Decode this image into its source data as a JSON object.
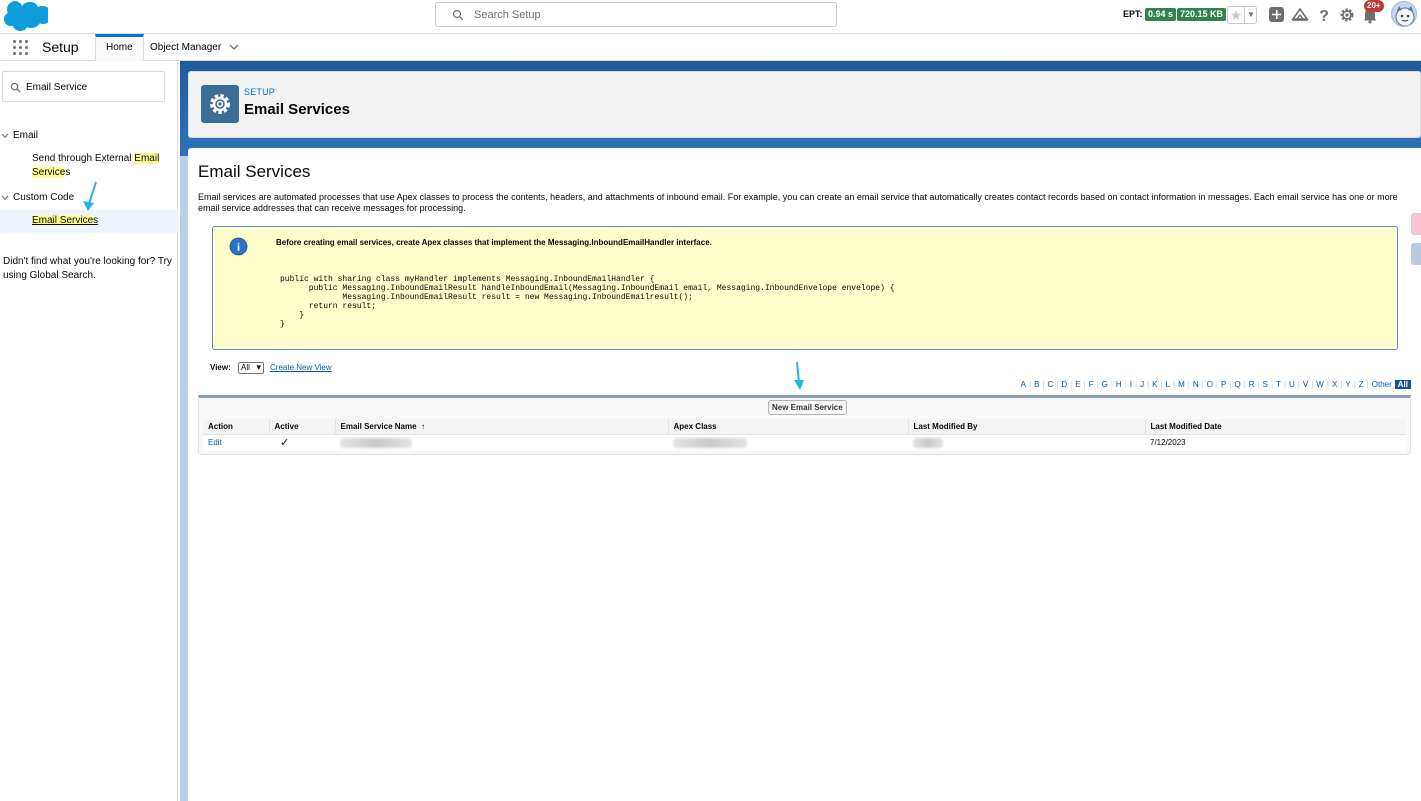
{
  "header": {
    "search_placeholder": "Search Setup",
    "ept_label": "EPT:",
    "ept_time": "0.94 s",
    "ept_size": "720.15 KB",
    "notification_count": "20+"
  },
  "context_bar": {
    "app_name": "Setup",
    "tabs": [
      {
        "label": "Home",
        "active": true
      },
      {
        "label": "Object Manager",
        "active": false
      }
    ]
  },
  "sidebar": {
    "quick_find_value": "Email Service",
    "groups": [
      {
        "label": "Email",
        "items": [
          {
            "label_pre": "Send through External ",
            "label_hl": "Email",
            "label_hl2": "Service",
            "label_post": "s"
          }
        ]
      },
      {
        "label": "Custom Code",
        "items": [
          {
            "label_hl": "Email Service",
            "label_post": "s",
            "selected": true
          }
        ]
      }
    ],
    "not_found_text": "Didn't find what you're looking for? Try using Global Search."
  },
  "page_header": {
    "kicker": "SETUP",
    "title": "Email Services",
    "icon": "gear-icon"
  },
  "content": {
    "title": "Email Services",
    "description": "Email services are automated processes that use Apex classes to process the contents, headers, and attachments of inbound email. For example, you can create an email service that automatically creates contact records based on contact information in messages. Each email service has one or more email service addresses that can receive messages for processing.",
    "info_heading": "Before creating email services, create Apex classes that implement the Messaging.InboundEmailHandler interface.",
    "code": "public with sharing class myHandler implements Messaging.InboundEmailHandler {\n      public Messaging.InboundEmailResult handleInboundEmail(Messaging.InboundEmail email, Messaging.InboundEnvelope envelope) {\n             Messaging.InboundEmailResult result = new Messaging.InboundEmailresult();\n      return result;\n    }\n}",
    "view_label": "View:",
    "view_selected": "All",
    "create_view_link": "Create New View",
    "alpha_filter": [
      "A",
      "B",
      "C",
      "D",
      "E",
      "F",
      "G",
      "H",
      "I",
      "J",
      "K",
      "L",
      "M",
      "N",
      "O",
      "P",
      "Q",
      "R",
      "S",
      "T",
      "U",
      "V",
      "W",
      "X",
      "Y",
      "Z",
      "Other",
      "All"
    ],
    "new_button": "New Email Service",
    "table": {
      "columns": [
        "Action",
        "Active",
        "Email Service Name",
        "Apex Class",
        "Last Modified By",
        "Last Modified Date"
      ],
      "sort_indicator": "↑",
      "rows": [
        {
          "action": "Edit",
          "active": "✓",
          "name": "",
          "apex_class": "",
          "modified_by": "",
          "modified_date": "7/12/2023"
        }
      ]
    }
  },
  "colors": {
    "brand": "#0176d3",
    "ept_green": "#2e844a",
    "info_bg": "#ffffcc",
    "highlight": "#ffff99",
    "annotation_arrow": "#1eb7e6"
  }
}
